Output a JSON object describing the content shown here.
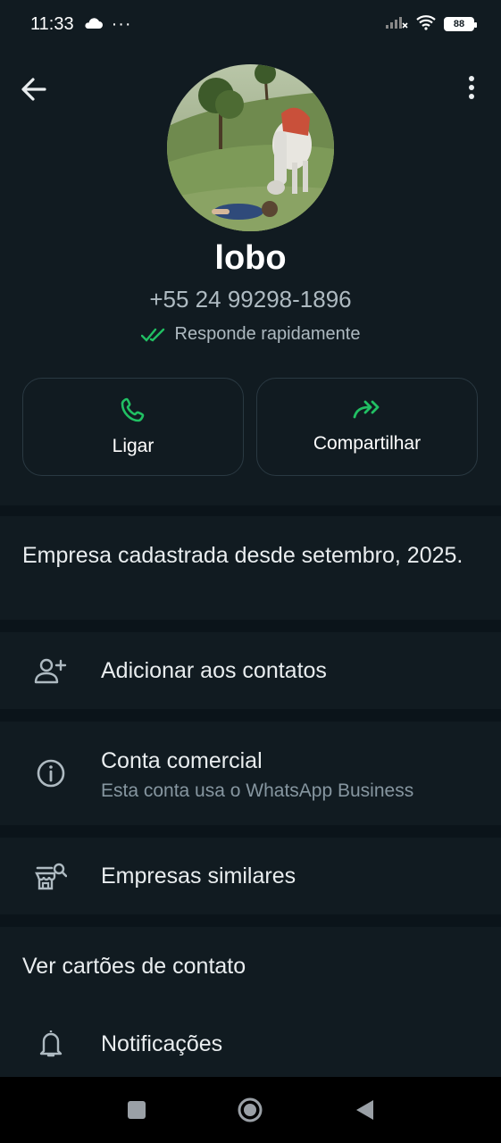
{
  "status_bar": {
    "time": "11:33",
    "dots": "···",
    "battery": "88",
    "icons": [
      "cloud-icon",
      "signal-icon",
      "wifi-icon",
      "battery-icon"
    ]
  },
  "profile": {
    "name": "lobo",
    "phone": "+55 24 99298-1896",
    "responds_label": "Responde rapidamente",
    "avatar_desc": "profile-photo"
  },
  "actions": {
    "call_label": "Ligar",
    "share_label": "Compartilhar"
  },
  "about": {
    "text": "Empresa cadastrada desde setembro, 2025."
  },
  "menu": {
    "add_contact": "Adicionar aos contatos",
    "business_account_title": "Conta comercial",
    "business_account_sub": "Esta conta usa o WhatsApp Business",
    "similar_businesses": "Empresas similares",
    "view_contact_cards": "Ver cartões de contato",
    "notifications": "Notificações"
  },
  "colors": {
    "accent_green": "#21c063",
    "background": "#0b141a",
    "surface": "#111b21",
    "secondary_text": "#8696a0"
  }
}
